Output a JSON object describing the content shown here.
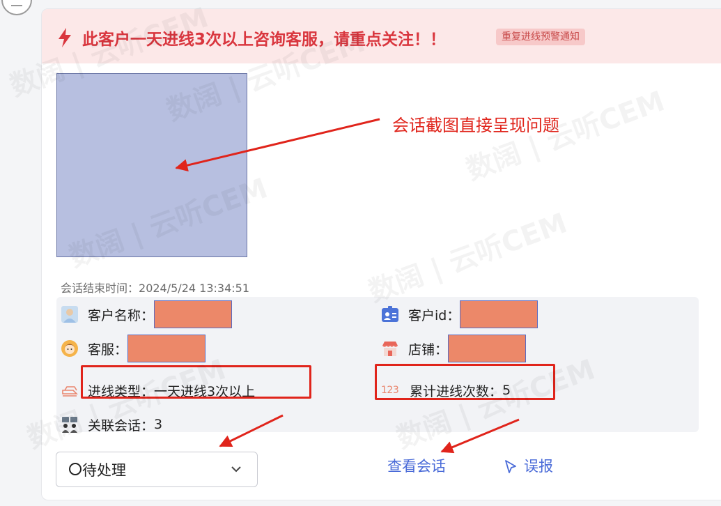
{
  "banner": {
    "message": "此客户一天进线3次以上咨询客服，请重点关注！！",
    "tag": "重复进线预警通知"
  },
  "screenshot": {
    "callout": "会话截图直接呈现问题"
  },
  "end_time": {
    "label": "会话结束时间：",
    "value": "2024/5/24 13:34:51"
  },
  "fields": {
    "customer_name": {
      "label": "客户名称："
    },
    "customer_id": {
      "label": "客户id："
    },
    "agent": {
      "label": "客服："
    },
    "store": {
      "label": "店铺："
    },
    "inbound_type": {
      "label": "进线类型：",
      "value": "一天进线3次以上"
    },
    "inbound_count": {
      "label": "累计进线次数：",
      "value": "5"
    },
    "related_sessions": {
      "label": "关联会话：",
      "value": "3"
    }
  },
  "count_icon_text": "123",
  "status_select": {
    "value": "待处理"
  },
  "actions": {
    "view_session": "查看会话",
    "report_error": "误报"
  },
  "watermark": {
    "brand": "数阔",
    "sep": "|",
    "product": "云听CEM"
  },
  "colors": {
    "alert_red": "#d9363e",
    "annotation_red": "#e0241b",
    "link_blue": "#4a6bd8",
    "redaction": "#ec8869"
  }
}
